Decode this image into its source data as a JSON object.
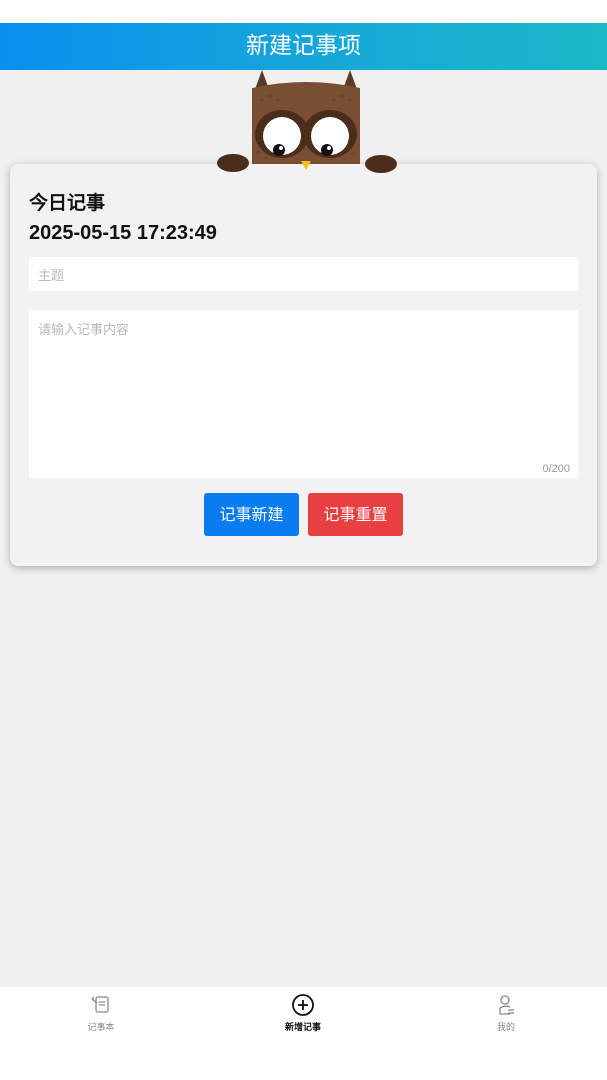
{
  "header": {
    "title": "新建记事项"
  },
  "card": {
    "title": "今日记事",
    "datetime": "2025-05-15 17:23:49",
    "subject_placeholder": "主题",
    "content_placeholder": "请输入记事内容",
    "char_counter": "0/200",
    "create_button": "记事新建",
    "reset_button": "记事重置"
  },
  "tabbar": {
    "items": [
      {
        "label": "记事本",
        "icon": "notebook-icon",
        "active": false
      },
      {
        "label": "新增记事",
        "icon": "add-circle-icon",
        "active": true
      },
      {
        "label": "我的",
        "icon": "user-profile-icon",
        "active": false
      }
    ]
  },
  "colors": {
    "header_gradient_start": "#0a8ff0",
    "header_gradient_end": "#1bb8c8",
    "create_button": "#0a7cf2",
    "reset_button": "#e84040",
    "background": "#f0f0f0"
  }
}
